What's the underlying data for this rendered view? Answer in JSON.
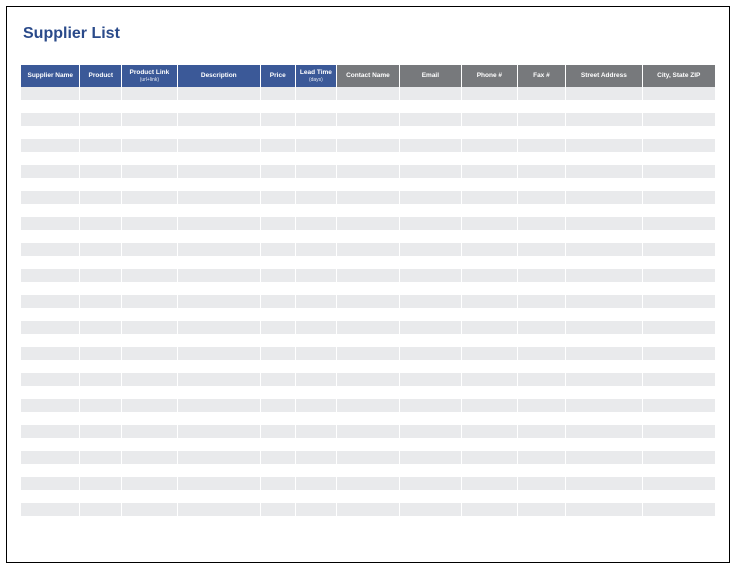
{
  "title": "Supplier List",
  "columns": [
    {
      "label": "Supplier Name",
      "sub": "",
      "group": "blue"
    },
    {
      "label": "Product",
      "sub": "",
      "group": "blue"
    },
    {
      "label": "Product Link",
      "sub": "(url+link)",
      "group": "blue"
    },
    {
      "label": "Description",
      "sub": "",
      "group": "blue"
    },
    {
      "label": "Price",
      "sub": "",
      "group": "blue"
    },
    {
      "label": "Lead Time",
      "sub": "(days)",
      "group": "blue"
    },
    {
      "label": "Contact Name",
      "sub": "",
      "group": "gray"
    },
    {
      "label": "Email",
      "sub": "",
      "group": "gray"
    },
    {
      "label": "Phone #",
      "sub": "",
      "group": "gray"
    },
    {
      "label": "Fax #",
      "sub": "",
      "group": "gray"
    },
    {
      "label": "Street Address",
      "sub": "",
      "group": "gray"
    },
    {
      "label": "City, State  ZIP",
      "sub": "",
      "group": "gray"
    }
  ],
  "row_count": 34
}
